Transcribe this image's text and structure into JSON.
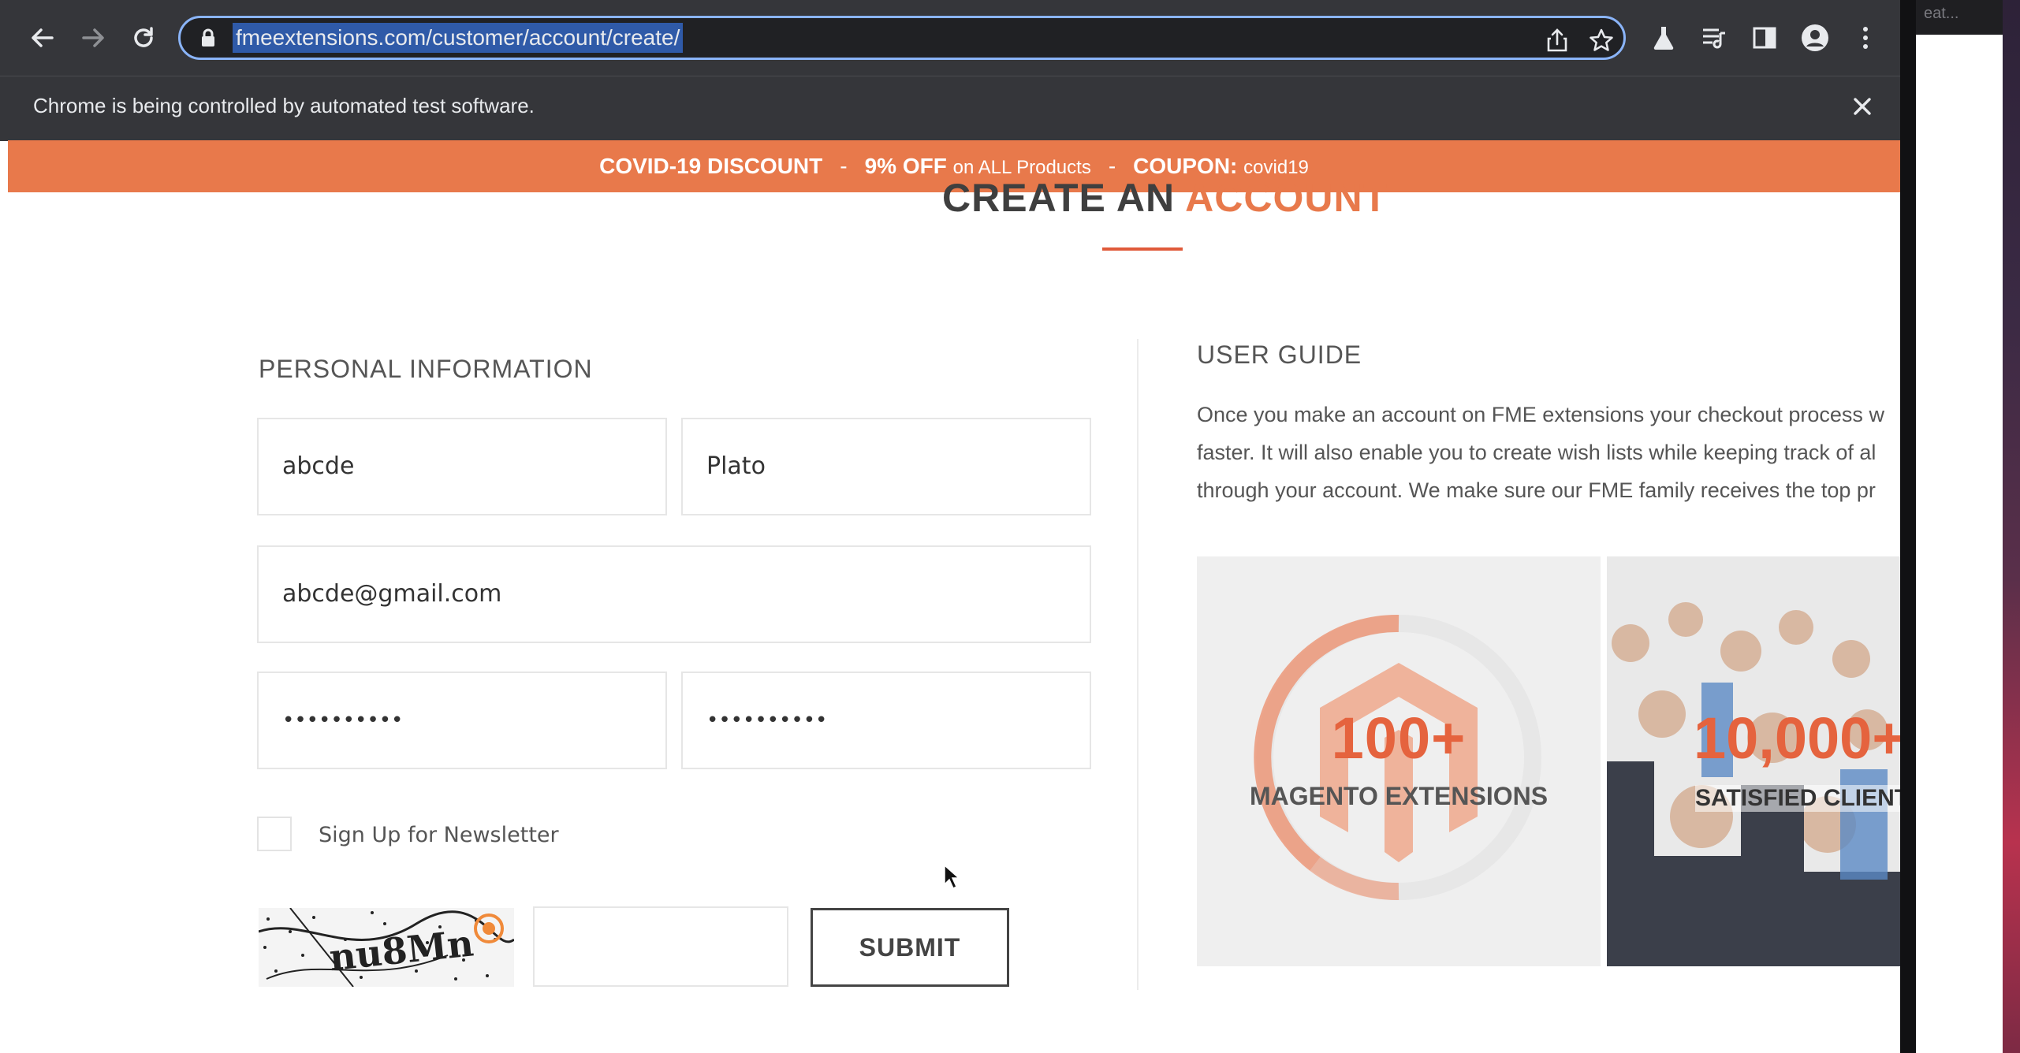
{
  "browser": {
    "url": "fmeextensions.com/customer/account/create/",
    "infobar_text": "Chrome is being controlled by automated test software.",
    "icons": {
      "back": "arrow-left-icon",
      "forward": "arrow-right-icon",
      "reload": "reload-icon",
      "lock": "lock-icon",
      "share": "share-icon",
      "bookmark": "star-icon",
      "labs": "flask-icon",
      "media": "media-queue-icon",
      "side_panel": "side-panel-icon",
      "profile": "profile-icon",
      "menu": "kebab-menu-icon",
      "close": "close-icon"
    }
  },
  "second_window": {
    "title_fragment": "eat..."
  },
  "promo": {
    "discount_label": "COVID-19 DISCOUNT",
    "dash1": "-",
    "percent": "9% OFF",
    "products_text": "on ALL Products",
    "dash2": "-",
    "coupon_label": "COUPON:",
    "coupon_code": "covid19",
    "bg_color": "#e8794b"
  },
  "page": {
    "heading_part1": "CREATE AN",
    "heading_part2": "ACCOUNT",
    "personal_info_title": "PERSONAL INFORMATION",
    "fields": {
      "first_name": "abcde",
      "last_name": "Plato",
      "email": "abcde@gmail.com",
      "password": "••••••••••",
      "confirm_password": "••••••••••"
    },
    "newsletter_label": "Sign Up for Newsletter",
    "newsletter_checked": false,
    "captcha_text": "nu8Mn",
    "captcha_input": "",
    "submit_label": "SUBMIT",
    "user_guide_title": "USER GUIDE",
    "user_guide_lines": [
      "Once you make an account on FME extensions your checkout process w",
      "faster. It will also enable you to create wish lists while keeping track of al",
      "through your account. We make sure our FME family receives the top pr"
    ],
    "banner1": {
      "number": "100+",
      "label": "MAGENTO EXTENSIONS"
    },
    "banner2": {
      "number": "10,000+",
      "label": "SATISFIED CLIENT"
    },
    "accent_color": "#e8794b"
  }
}
